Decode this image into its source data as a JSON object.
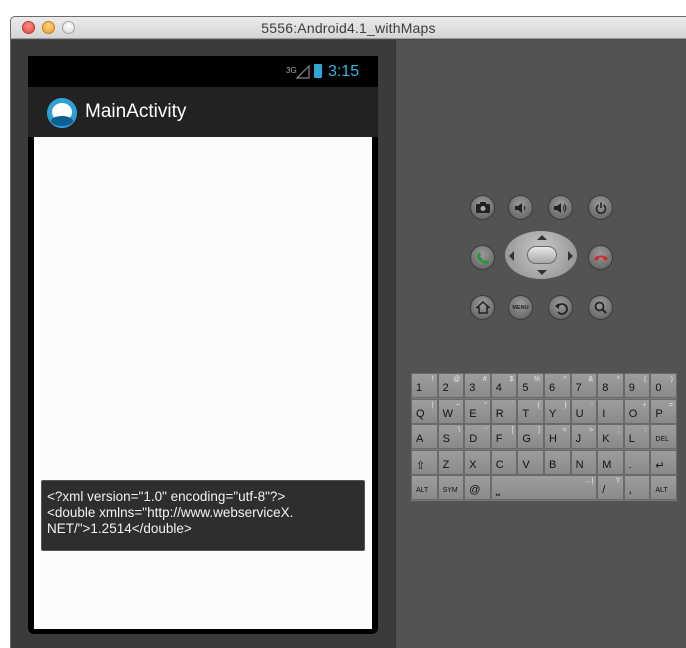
{
  "window": {
    "title": "5556:Android4.1_withMaps"
  },
  "statusbar": {
    "network": "3G",
    "time": "3:15"
  },
  "actionbar": {
    "title": "MainActivity"
  },
  "toast": {
    "text": "<?xml version=\"1.0\" encoding=\"utf-8\"?>\n<double xmlns=\"http://www.webserviceX.\nNET/\">1.2514</double>"
  },
  "controls": {
    "top_row": [
      "camera-icon",
      "volume-down-icon",
      "volume-up-icon",
      "power-icon"
    ],
    "call": "call-icon",
    "end_call": "end-call-icon",
    "bottom_row": [
      "home-icon",
      "menu-icon",
      "back-icon",
      "search-icon"
    ],
    "menu_label": "MENU"
  },
  "keyboard": {
    "row1": [
      {
        "k": "1",
        "s": "!"
      },
      {
        "k": "2",
        "s": "@"
      },
      {
        "k": "3",
        "s": "#"
      },
      {
        "k": "4",
        "s": "$"
      },
      {
        "k": "5",
        "s": "%"
      },
      {
        "k": "6",
        "s": "^"
      },
      {
        "k": "7",
        "s": "&"
      },
      {
        "k": "8",
        "s": "*"
      },
      {
        "k": "9",
        "s": "("
      },
      {
        "k": "0",
        "s": ")"
      }
    ],
    "row2": [
      {
        "k": "Q",
        "s": "|"
      },
      {
        "k": "W",
        "s": "~"
      },
      {
        "k": "E",
        "s": "\""
      },
      {
        "k": "R",
        "s": "`"
      },
      {
        "k": "T",
        "s": "{"
      },
      {
        "k": "Y",
        "s": "}"
      },
      {
        "k": "U",
        "s": "-"
      },
      {
        "k": "I",
        "s": ""
      },
      {
        "k": "O",
        "s": "+"
      },
      {
        "k": "P",
        "s": "="
      }
    ],
    "row3": [
      {
        "k": "A",
        "s": ""
      },
      {
        "k": "S",
        "s": "\\"
      },
      {
        "k": "D",
        "s": "'"
      },
      {
        "k": "F",
        "s": "["
      },
      {
        "k": "G",
        "s": "]"
      },
      {
        "k": "H",
        "s": "<"
      },
      {
        "k": "J",
        "s": ">"
      },
      {
        "k": "K",
        "s": ";"
      },
      {
        "k": "L",
        "s": ":"
      },
      {
        "k": "DEL",
        "s": ""
      }
    ],
    "row4": [
      {
        "k": "⇧",
        "s": ""
      },
      {
        "k": "Z",
        "s": ""
      },
      {
        "k": "X",
        "s": ""
      },
      {
        "k": "C",
        "s": ""
      },
      {
        "k": "V",
        "s": ""
      },
      {
        "k": "B",
        "s": ""
      },
      {
        "k": "N",
        "s": ""
      },
      {
        "k": "M",
        "s": ""
      },
      {
        "k": ".",
        "s": ""
      },
      {
        "k": "↵",
        "s": ""
      }
    ],
    "row5": [
      {
        "k": "ALT",
        "s": ""
      },
      {
        "k": "SYM",
        "s": ""
      },
      {
        "k": "@",
        "s": ""
      },
      {
        "k": "⎵",
        "s": "→|"
      },
      {
        "k": "/",
        "s": "?"
      },
      {
        "k": ",",
        "s": ""
      },
      {
        "k": "ALT",
        "s": ""
      }
    ]
  }
}
